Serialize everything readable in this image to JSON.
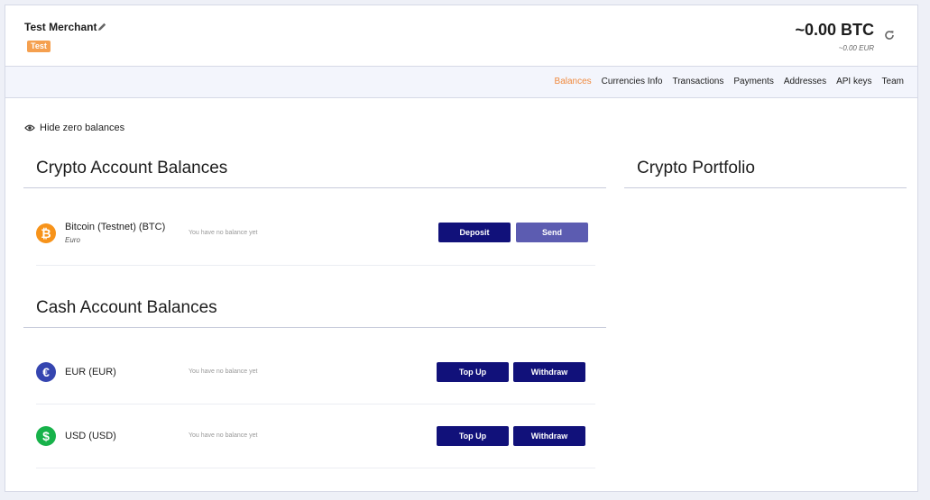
{
  "merchant": {
    "name": "Test Merchant",
    "badge": "Test"
  },
  "totals": {
    "btc": "~0.00 BTC",
    "eur": "~0.00 EUR"
  },
  "nav": [
    "Balances",
    "Currencies Info",
    "Transactions",
    "Payments",
    "Addresses",
    "API keys",
    "Team"
  ],
  "filters": {
    "hide_zero_label": "Hide zero balances"
  },
  "crypto": {
    "title": "Crypto Account Balances",
    "rows": [
      {
        "name": "Bitcoin (Testnet) (BTC)",
        "sub": "Euro",
        "balance": "You have no balance yet",
        "btn1": "Deposit",
        "btn2": "Send"
      }
    ]
  },
  "portfolio": {
    "title": "Crypto Portfolio"
  },
  "cash": {
    "title": "Cash Account Balances",
    "rows": [
      {
        "name": "EUR (EUR)",
        "balance": "You have no balance yet",
        "btn1": "Top Up",
        "btn2": "Withdraw"
      },
      {
        "name": "USD (USD)",
        "balance": "You have no balance yet",
        "btn1": "Top Up",
        "btn2": "Withdraw"
      }
    ]
  },
  "icons": {
    "edit": "pencil-icon",
    "refresh": "refresh-icon",
    "eye": "eye-icon",
    "btc": "bitcoin-icon",
    "eur": "euro-icon",
    "usd": "dollar-icon"
  },
  "colors": {
    "primary": "#11117a",
    "primary_light": "#5c5cb1",
    "accent": "#f08a3e",
    "badge": "#f5a04f",
    "btc": "#f7931a",
    "eur": "#3545b0",
    "usd": "#17b24a"
  }
}
